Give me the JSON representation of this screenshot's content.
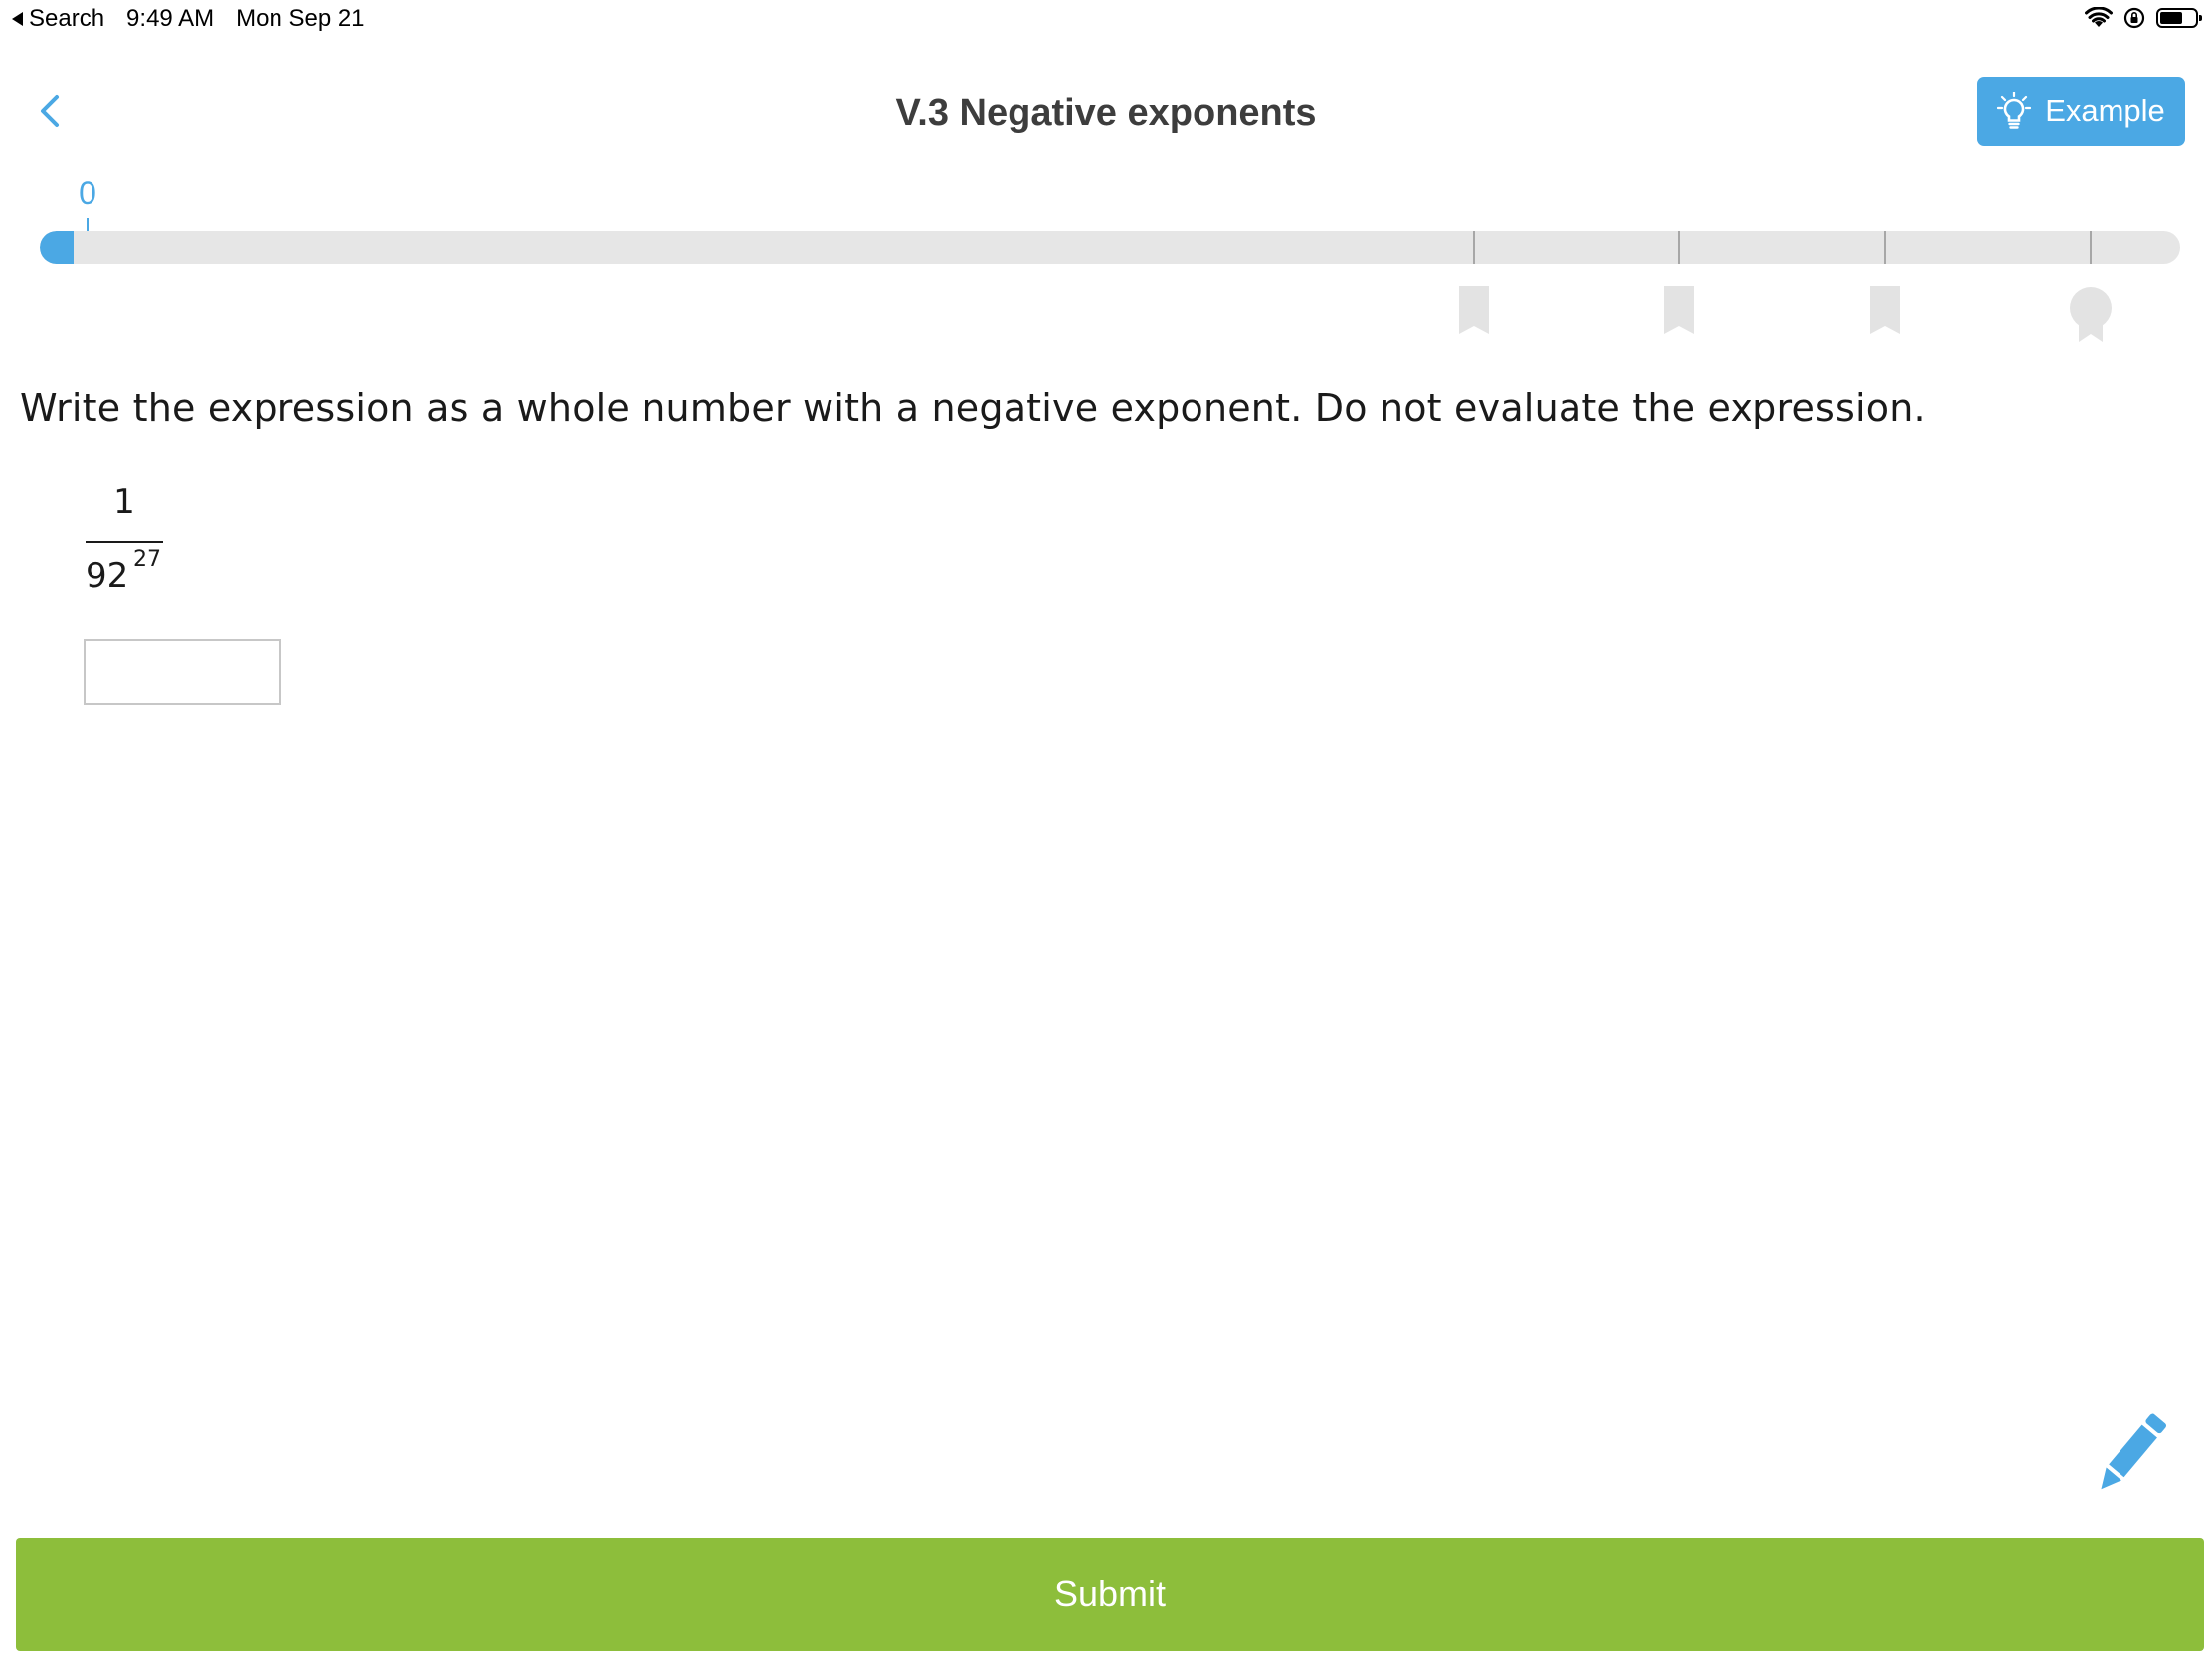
{
  "status_bar": {
    "back_app": "Search",
    "time": "9:49 AM",
    "date": "Mon Sep 21"
  },
  "header": {
    "title": "V.3 Negative exponents",
    "example_label": "Example"
  },
  "progress": {
    "score": "0",
    "fill_fraction": 0.016,
    "milestone_fractions": [
      0.67,
      0.766,
      0.862,
      0.958
    ],
    "milestones": [
      "bookmark-icon",
      "bookmark-icon",
      "bookmark-icon",
      "award-ribbon-icon"
    ]
  },
  "question": {
    "prompt": "Write the expression as a whole number with a negative exponent. Do not evaluate the expression.",
    "numerator": "1",
    "base": "92",
    "exponent": "27",
    "answer_value": ""
  },
  "footer": {
    "submit_label": "Submit"
  },
  "colors": {
    "accent_blue": "#4ba8e4",
    "submit_green": "#8dbe3b",
    "track_gray": "#e6e6e6",
    "title_text": "#3d3d3d"
  }
}
